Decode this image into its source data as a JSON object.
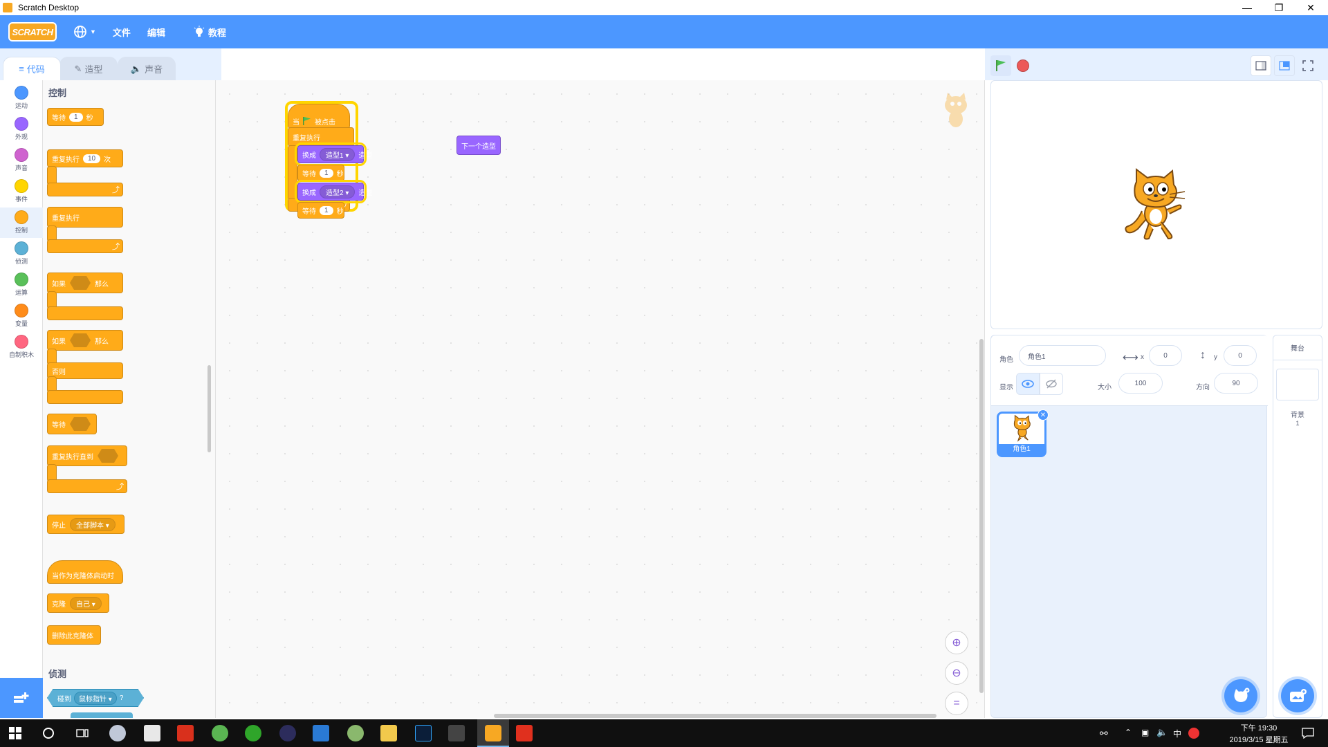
{
  "window": {
    "title": "Scratch Desktop"
  },
  "menubar": {
    "logo": "SCRATCH",
    "file": "文件",
    "edit": "编辑",
    "tutorials": "教程"
  },
  "tabs": {
    "code": "代码",
    "costumes": "造型",
    "sounds": "声音"
  },
  "categories": [
    {
      "label": "运动",
      "color": "#4c97ff"
    },
    {
      "label": "外观",
      "color": "#9966ff"
    },
    {
      "label": "声音",
      "color": "#cf63cf"
    },
    {
      "label": "事件",
      "color": "#ffd500"
    },
    {
      "label": "控制",
      "color": "#ffab19"
    },
    {
      "label": "侦测",
      "color": "#5cb1d6"
    },
    {
      "label": "运算",
      "color": "#59c059"
    },
    {
      "label": "变量",
      "color": "#ff8c1a"
    },
    {
      "label": "自制积木",
      "color": "#ff6680"
    }
  ],
  "palette": {
    "control_title": "控制",
    "wait": {
      "label": "等待",
      "value": "1",
      "unit": "秒"
    },
    "repeat": {
      "label": "重复执行",
      "value": "10",
      "unit": "次"
    },
    "forever": "重复执行",
    "if_then": {
      "if": "如果",
      "then": "那么"
    },
    "if_else": {
      "if": "如果",
      "then": "那么",
      "else": "否则"
    },
    "wait_until": "等待",
    "repeat_until": "重复执行直到",
    "stop": {
      "label": "停止",
      "option": "全部脚本"
    },
    "clone_start": "当作为克隆体启动时",
    "create_clone": {
      "label": "克隆",
      "option": "自己"
    },
    "delete_clone": "删除此克隆体",
    "sensing_title": "侦测",
    "touching": {
      "label": "碰到",
      "option": "鼠标指针",
      "suffix": "?"
    }
  },
  "script": {
    "hat": "当 被点击",
    "hat_prefix": "当",
    "hat_suffix": "被点击",
    "forever": "重复执行",
    "switch1": {
      "label": "换成",
      "costume": "造型1",
      "suffix": "造型"
    },
    "wait1": {
      "label": "等待",
      "value": "1",
      "unit": "秒"
    },
    "switch2": {
      "label": "换成",
      "costume": "造型2",
      "suffix": "造型"
    },
    "wait2": {
      "label": "等待",
      "value": "1",
      "unit": "秒"
    },
    "next_costume": "下一个造型"
  },
  "sprite_info": {
    "sprite_label": "角色",
    "sprite_name": "角色1",
    "x_label": "x",
    "x_value": "0",
    "y_label": "y",
    "y_value": "0",
    "show_label": "显示",
    "size_label": "大小",
    "size_value": "100",
    "direction_label": "方向",
    "direction_value": "90"
  },
  "sprites": [
    {
      "name": "角色1"
    }
  ],
  "stage_pane": {
    "title": "舞台",
    "backdrops_label": "背景",
    "backdrops_count": "1"
  },
  "taskbar": {
    "time": "下午 19:30",
    "date": "2019/3/15 星期五",
    "ime": "中"
  }
}
